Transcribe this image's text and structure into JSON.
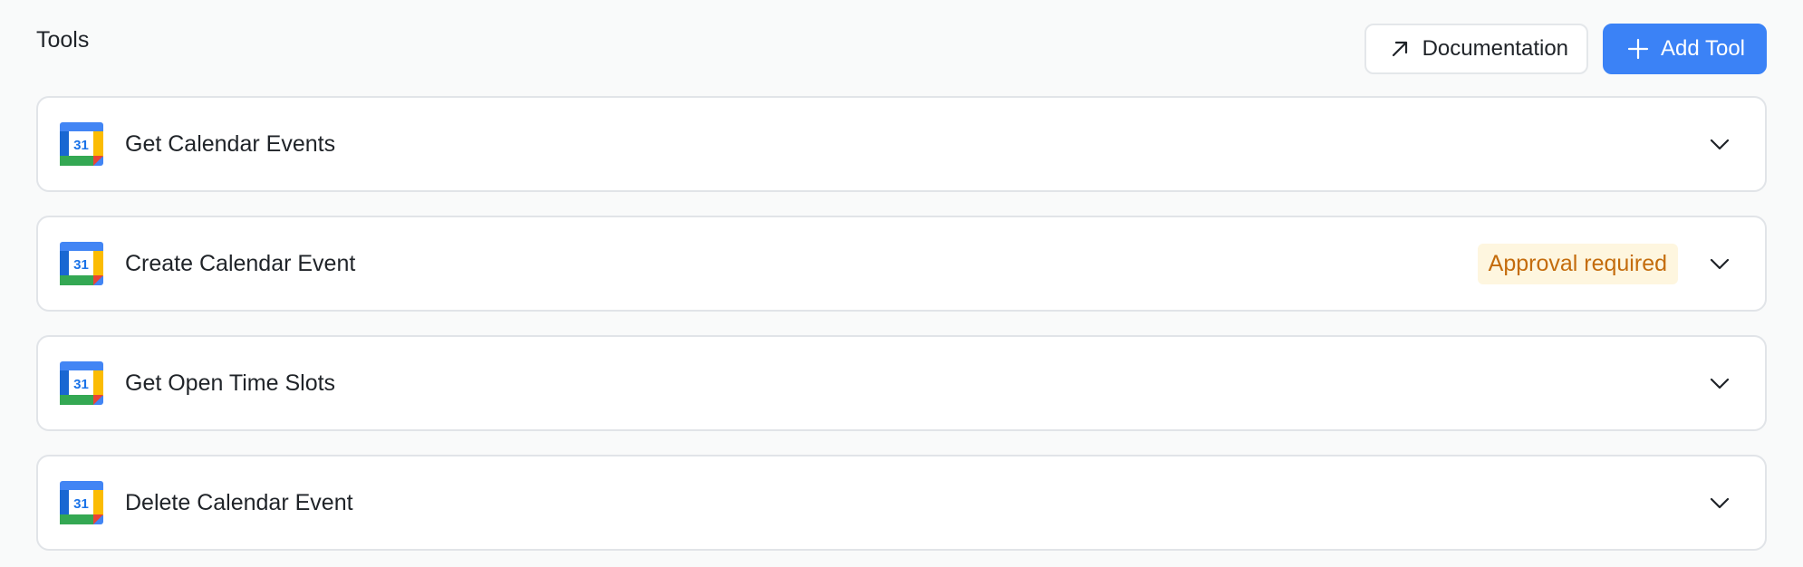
{
  "section": {
    "title": "Tools"
  },
  "actions": {
    "documentation_label": "Documentation",
    "add_tool_label": "Add Tool"
  },
  "icon": {
    "calendar_day": "31",
    "name": "google-calendar-icon"
  },
  "tools": [
    {
      "name": "Get Calendar Events",
      "badge": ""
    },
    {
      "name": "Create Calendar Event",
      "badge": "Approval required"
    },
    {
      "name": "Get Open Time Slots",
      "badge": ""
    },
    {
      "name": "Delete Calendar Event",
      "badge": ""
    }
  ],
  "colors": {
    "accent": "#3b82f6",
    "badge_bg": "#fef6df",
    "badge_text": "#c46c0c"
  }
}
